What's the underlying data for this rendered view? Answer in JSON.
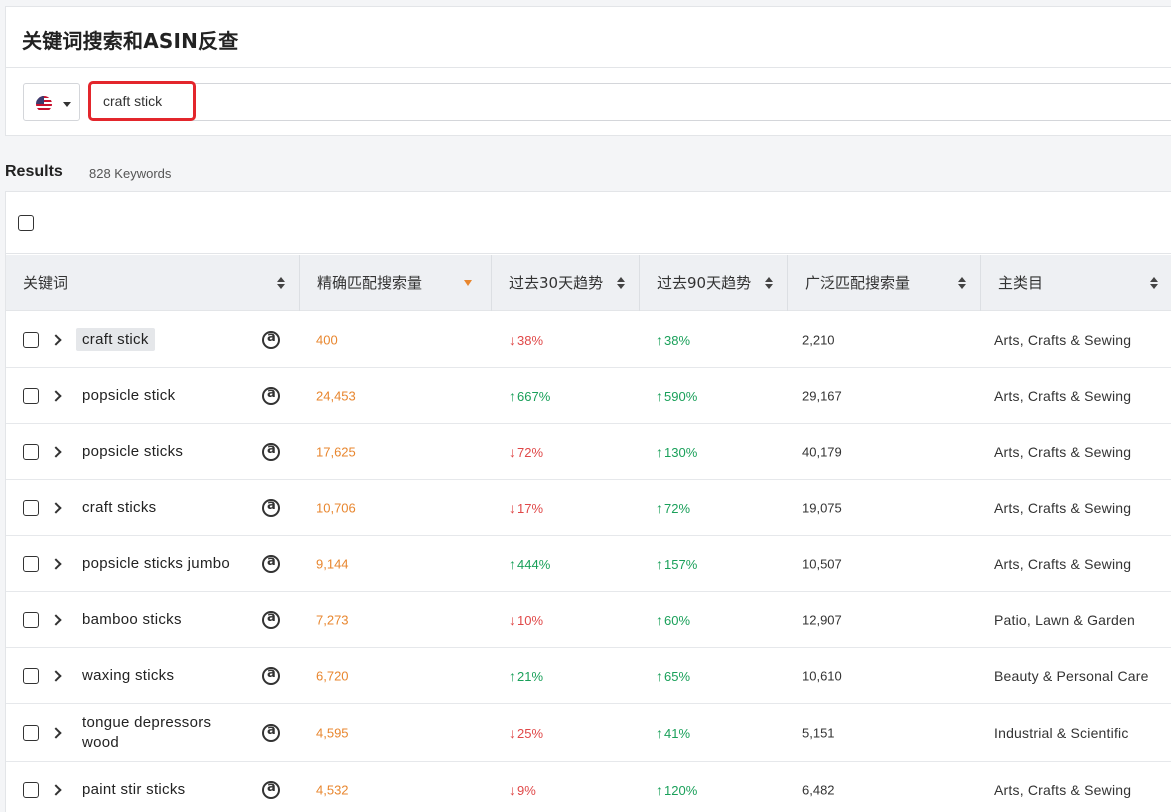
{
  "page": {
    "title": "关键词搜索和ASIN反查"
  },
  "search": {
    "country_icon": "us-flag-icon",
    "value": "craft stick"
  },
  "results": {
    "label": "Results",
    "count": "828 Keywords"
  },
  "columns": [
    {
      "label": "关键词"
    },
    {
      "label": "精确匹配搜索量"
    },
    {
      "label": "过去30天趋势"
    },
    {
      "label": "过去90天趋势"
    },
    {
      "label": "广泛匹配搜索量"
    },
    {
      "label": "主类目"
    }
  ],
  "colors": {
    "exact": "#e8862e",
    "up": "#1aa05a",
    "down": "#e04848",
    "highlight": "#e3262c"
  },
  "rows": [
    {
      "keyword": "craft stick",
      "exact": "400",
      "t30_dir": "down",
      "t30": "38%",
      "t90_dir": "up",
      "t90": "38%",
      "broad": "2,210",
      "category": "Arts, Crafts & Sewing"
    },
    {
      "keyword": "popsicle stick",
      "exact": "24,453",
      "t30_dir": "up",
      "t30": "667%",
      "t90_dir": "up",
      "t90": "590%",
      "broad": "29,167",
      "category": "Arts, Crafts & Sewing"
    },
    {
      "keyword": "popsicle sticks",
      "exact": "17,625",
      "t30_dir": "down",
      "t30": "72%",
      "t90_dir": "up",
      "t90": "130%",
      "broad": "40,179",
      "category": "Arts, Crafts & Sewing"
    },
    {
      "keyword": "craft sticks",
      "exact": "10,706",
      "t30_dir": "down",
      "t30": "17%",
      "t90_dir": "up",
      "t90": "72%",
      "broad": "19,075",
      "category": "Arts, Crafts & Sewing"
    },
    {
      "keyword": "popsicle sticks jumbo",
      "exact": "9,144",
      "t30_dir": "up",
      "t30": "444%",
      "t90_dir": "up",
      "t90": "157%",
      "broad": "10,507",
      "category": "Arts, Crafts & Sewing"
    },
    {
      "keyword": "bamboo sticks",
      "exact": "7,273",
      "t30_dir": "down",
      "t30": "10%",
      "t90_dir": "up",
      "t90": "60%",
      "broad": "12,907",
      "category": "Patio, Lawn & Garden"
    },
    {
      "keyword": "waxing sticks",
      "exact": "6,720",
      "t30_dir": "up",
      "t30": "21%",
      "t90_dir": "up",
      "t90": "65%",
      "broad": "10,610",
      "category": "Beauty & Personal Care"
    },
    {
      "keyword": "tongue depressors wood",
      "exact": "4,595",
      "t30_dir": "down",
      "t30": "25%",
      "t90_dir": "up",
      "t90": "41%",
      "broad": "5,151",
      "category": "Industrial & Scientific"
    },
    {
      "keyword": "paint stir sticks",
      "exact": "4,532",
      "t30_dir": "down",
      "t30": "9%",
      "t90_dir": "up",
      "t90": "120%",
      "broad": "6,482",
      "category": "Arts, Crafts & Sewing"
    }
  ]
}
